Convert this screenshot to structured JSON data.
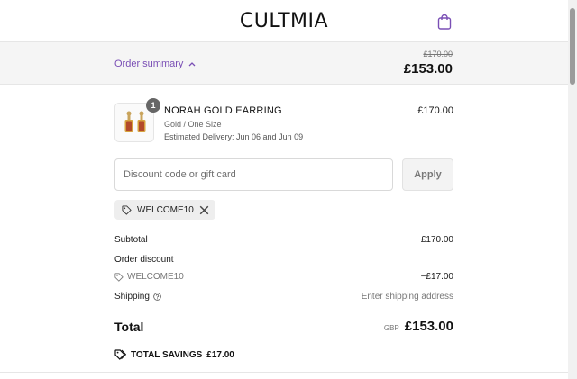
{
  "brand": {
    "logo_text": "CULTMIA",
    "accent_color": "#7a4fb5"
  },
  "header": {
    "cart_icon": "shopping-bag-icon"
  },
  "summary_bar": {
    "toggle_label": "Order summary",
    "original_price": "£170.00",
    "total": "£153.00"
  },
  "product": {
    "quantity": "1",
    "name": "NORAH GOLD EARRING",
    "variant": "Gold / One Size",
    "delivery": "Estimated Delivery: Jun 06 and Jun 09",
    "price": "£170.00"
  },
  "discount": {
    "placeholder": "Discount code or gift card",
    "apply_label": "Apply",
    "applied_code": "WELCOME10"
  },
  "totals": {
    "subtotal_label": "Subtotal",
    "subtotal_value": "£170.00",
    "order_discount_label": "Order discount",
    "discount_code": "WELCOME10",
    "discount_value": "−£17.00",
    "shipping_label": "Shipping",
    "shipping_value": "Enter shipping address",
    "total_label": "Total",
    "currency": "GBP",
    "total_value": "£153.00",
    "savings_label": "TOTAL SAVINGS",
    "savings_value": "£17.00"
  }
}
